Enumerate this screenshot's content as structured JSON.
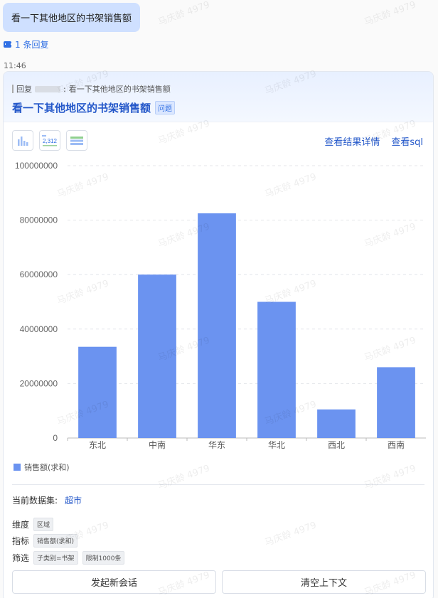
{
  "user_message": "看一下其他地区的书架销售额",
  "reply_count": "1 条回复",
  "time": "11:46",
  "card": {
    "quote_prefix": "回复",
    "quote_text": "看一下其他地区的书架销售额",
    "title": "看一下其他地区的书架销售额",
    "title_tag": "问题",
    "links": {
      "details": "查看结果详情",
      "sql": "查看sql"
    },
    "dataset_label": "当前数据集:",
    "dataset_value": "超市",
    "dimension_label": "维度",
    "dimension_chip": "区域",
    "metric_label": "指标",
    "metric_chip": "销售额(求和)",
    "filter_label": "筛选",
    "filter_chips": [
      "子类别=书架",
      "限制1000条"
    ],
    "buttons": {
      "new_session": "发起新会话",
      "clear_context": "清空上下文"
    },
    "legend": "销售额(求和)"
  },
  "watermark": "马庆龄 4979",
  "chart_data": {
    "type": "bar",
    "categories": [
      "东北",
      "中南",
      "华东",
      "华北",
      "西北",
      "西南"
    ],
    "values": [
      33500000,
      60000000,
      82500000,
      50000000,
      10500000,
      26000000
    ],
    "series_name": "销售额(求和)",
    "ylim": [
      0,
      100000000
    ],
    "yticks": [
      "0",
      "20000000",
      "40000000",
      "60000000",
      "80000000",
      "100000000"
    ],
    "color": "#6b93f0",
    "grid": true,
    "legend_position": "bottom-left"
  }
}
